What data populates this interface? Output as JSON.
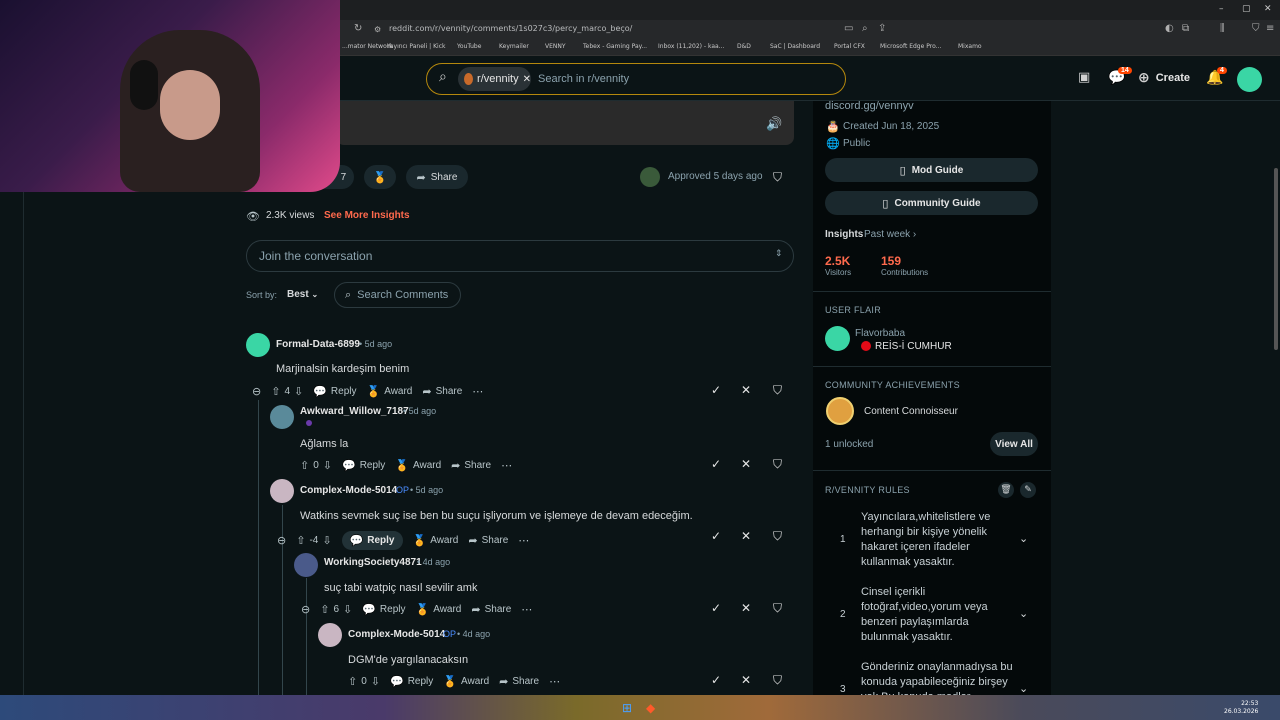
{
  "browser": {
    "url": "reddit.com/r/vennity/comments/1s027c3/percy_marco_beço/",
    "bookmarks": [
      "...mator Network",
      "Yayıncı Paneli | Kick",
      "YouTube",
      "Keymailer",
      "VENNY",
      "Tebex - Gaming Pay...",
      "Inbox (11,202) - kaa...",
      "D&D",
      "SaC | Dashboard",
      "Portal CFX",
      "Microsoft Edge Pro...",
      "Mixamo"
    ],
    "window_controls": [
      "–",
      "▢",
      "✕"
    ]
  },
  "header": {
    "chip_label": "r/vennity",
    "search_placeholder": "Search in r/vennity",
    "create_label": "Create",
    "chat_badge": "14",
    "notif_badge": "4"
  },
  "post": {
    "comment_count": "7",
    "share_label": "Share",
    "approved_text": "Approved 5 days ago",
    "views": "2.3K views",
    "insights_link": "See More Insights",
    "join_placeholder": "Join the conversation",
    "sort_label": "Sort by:",
    "sort_value": "Best",
    "search_comments": "Search Comments"
  },
  "comments": [
    {
      "author": "Formal-Data-6899",
      "op": "",
      "time": "• 5d ago",
      "body": "Marjinalsin kardeşim benim",
      "score": "4",
      "reply": "Reply",
      "award": "Award",
      "share": "Share"
    },
    {
      "author": "Awkward_Willow_7187",
      "op": "",
      "time": "• 5d ago",
      "body": "Ağlams la",
      "score": "0",
      "reply": "Reply",
      "award": "Award",
      "share": "Share"
    },
    {
      "author": "Complex-Mode-5014",
      "op": "OP",
      "time": "• 5d ago",
      "body": "Watkins sevmek suç ise ben bu suçu işliyorum ve işlemeye de devam edeceğim.",
      "score": "-4",
      "reply": "Reply",
      "award": "Award",
      "share": "Share"
    },
    {
      "author": "WorkingSociety4871",
      "op": "",
      "time": "• 4d ago",
      "body": "suç tabi watpiç nasıl sevilir amk",
      "score": "6",
      "reply": "Reply",
      "award": "Award",
      "share": "Share"
    },
    {
      "author": "Complex-Mode-5014",
      "op": "OP",
      "time": "• 4d ago",
      "body": "DGM'de yargılanacaksın",
      "score": "0",
      "reply": "Reply",
      "award": "Award",
      "share": "Share"
    }
  ],
  "sidebar": {
    "link": "discord.gg/vennyv",
    "created": "Created Jun 18, 2025",
    "visibility": "Public",
    "mod_guide": "Mod Guide",
    "community_guide": "Community Guide",
    "insights_label": "Insights",
    "insights_period": "Past week ›",
    "visitors_value": "2.5K",
    "visitors_label": "Visitors",
    "contributions_value": "159",
    "contributions_label": "Contributions",
    "user_flair_head": "USER FLAIR",
    "flair_name": "Flavorbaba",
    "flair_tag": "REİS-İ CUMHUR",
    "achievements_head": "COMMUNITY ACHIEVEMENTS",
    "achievement": "Content Connoisseur",
    "unlocked": "1 unlocked",
    "view_all": "View All",
    "rules_head": "R/VENNITY RULES",
    "rules": [
      {
        "num": "1",
        "text": "Yayıncılara,whitelistlere ve herhangi bir kişiye yönelik hakaret içeren ifadeler kullanmak yasaktır."
      },
      {
        "num": "2",
        "text": "Cinsel içerikli fotoğraf,video,yorum veya benzeri paylaşımlarda bulunmak yasaktır."
      },
      {
        "num": "3",
        "text": "Gönderiniz onaylanmadıysa bu konuda yapabileceğiniz birşey yok.Bu konuda modlar"
      }
    ]
  },
  "taskbar": {
    "time": "22:53",
    "date": "26.03.2026"
  }
}
